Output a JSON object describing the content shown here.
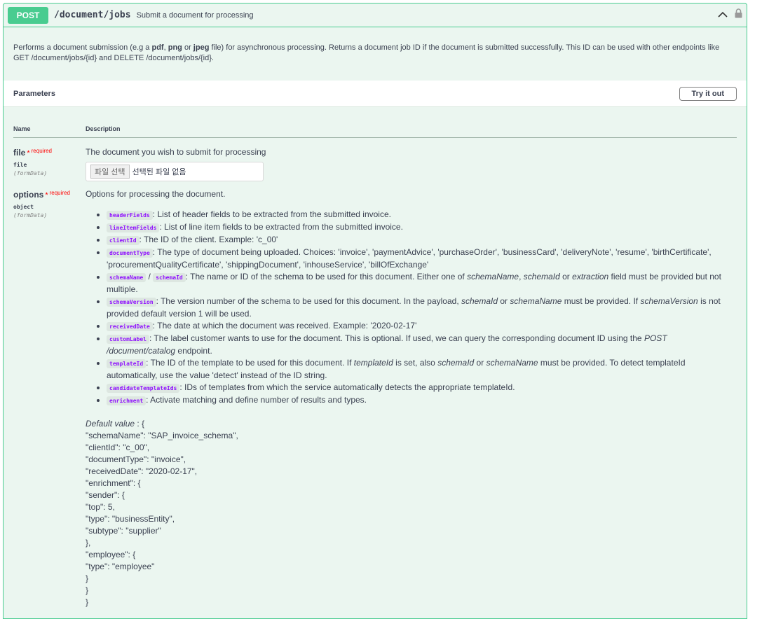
{
  "summary": {
    "method": "POST",
    "path": "/document/jobs",
    "description": "Submit a document for processing"
  },
  "description": {
    "part1": "Performs a document submission (e.g a ",
    "b1": "pdf",
    "part2": ", ",
    "b2": "png",
    "part3": " or ",
    "b3": "jpeg",
    "part4": " file) for asynchronous processing. Returns a document job ID if the document is submitted successfully. This ID can be used with other endpoints like GET /document/jobs/{id} and DELETE /document/jobs/{id}."
  },
  "parameters": {
    "title": "Parameters",
    "try_label": "Try it out",
    "col_name": "Name",
    "col_description": "Description"
  },
  "file_param": {
    "name": "file",
    "star": "*",
    "required": "required",
    "type": "file",
    "in": "(formData)",
    "desc": "The document you wish to submit for processing",
    "choose_label": "파일 선택",
    "no_file": "선택된 파일 없음"
  },
  "options_param": {
    "name": "options",
    "star": "*",
    "required": "required",
    "type": "object",
    "in": "(formData)",
    "desc": "Options for processing the document.",
    "items": {
      "i0": {
        "code": "headerFields",
        "text": ": List of header fields to be extracted from the submitted invoice."
      },
      "i1": {
        "code": "lineItemFields",
        "text": ": List of line item fields to be extracted from the submitted invoice."
      },
      "i2": {
        "code": "clientId",
        "text": ": The ID of the client. Example: 'c_00'"
      },
      "i3": {
        "code": "documentType",
        "text": ": The type of document being uploaded. Choices: 'invoice', 'paymentAdvice', 'purchaseOrder', 'businessCard', 'deliveryNote', 'resume', 'birthCertificate', 'procurementQualityCertificate', 'shippingDocument', 'inhouseService', 'billOfExchange'"
      },
      "i4": {
        "code": "schemaName",
        "sep": " / ",
        "code2": "schemaId",
        "t1": ": The name or ID of the schema to be used for this document. Either one of ",
        "e1": "schemaName",
        "t2": ", ",
        "e2": "schemaId",
        "t3": " or ",
        "e3": "extraction",
        "t4": " field must be provided but not multiple."
      },
      "i5": {
        "code": "schemaVersion",
        "t1": ": The version number of the schema to be used for this document. In the payload, ",
        "e1": "schemaId",
        "t2": " or ",
        "e2": "schemaName",
        "t3": " must be provided. If ",
        "e3": "schemaVersion",
        "t4": " is not provided default version 1 will be used."
      },
      "i6": {
        "code": "receivedDate",
        "text": ": The date at which the document was received. Example: '2020-02-17'"
      },
      "i7": {
        "code": "customLabel",
        "t1": ": The label customer wants to use for the document. This is optional. If used, we can query the corresponding document ID using the ",
        "e1": "POST /document/catalog",
        "t2": " endpoint."
      },
      "i8": {
        "code": "templateId",
        "t1": ": The ID of the template to be used for this document. If ",
        "e1": "templateId",
        "t2": " is set, also ",
        "e2": "schemaId",
        "t3": " or ",
        "e3": "schemaName",
        "t4": " must be provided. To detect templateId automatically, use the value 'detect' instead of the ID string."
      },
      "i9": {
        "code": "candidateTemplateIds",
        "text": ": IDs of templates from which the service automatically detects the appropriate templateId."
      },
      "i10": {
        "code": "enrichment",
        "text": ": Activate matching and define number of results and types."
      }
    },
    "default_label": "Default value",
    "default_value": " : {\n\"schemaName\": \"SAP_invoice_schema\",\n\"clientId\": \"c_00\",\n\"documentType\": \"invoice\",\n\"receivedDate\": \"2020-02-17\",\n\"enrichment\": {\n\"sender\": {\n\"top\": 5,\n\"type\": \"businessEntity\",\n\"subtype\": \"supplier\"\n},\n\"employee\": {\n\"type\": \"employee\"\n}\n}\n}"
  },
  "colors": {
    "accent": "#49cc90",
    "background": "#ebf6f0",
    "code": "#9012fe",
    "required": "#ff0000"
  }
}
